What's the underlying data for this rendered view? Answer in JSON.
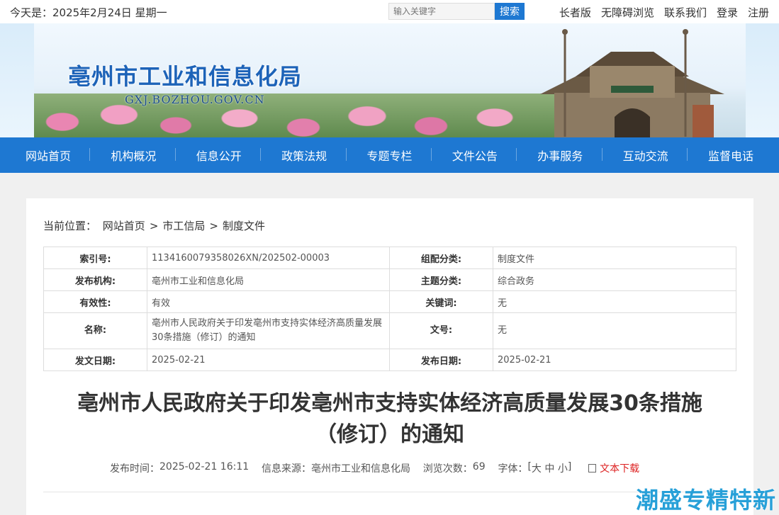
{
  "topbar": {
    "date_text": "今天是：2025年2月24日 星期一",
    "search_placeholder": "输入关键字",
    "search_button": "搜索",
    "links": [
      "长者版",
      "无障碍浏览",
      "联系我们",
      "登录",
      "注册"
    ]
  },
  "banner": {
    "title": "亳州市工业和信息化局",
    "domain": "GXJ.BOZHOU.GOV.CN"
  },
  "nav": [
    "网站首页",
    "机构概况",
    "信息公开",
    "政策法规",
    "专题专栏",
    "文件公告",
    "办事服务",
    "互动交流",
    "监督电话"
  ],
  "breadcrumb": {
    "label": "当前位置：",
    "items": [
      "网站首页",
      "市工信局",
      "制度文件"
    ],
    "sep": ">"
  },
  "meta": [
    {
      "k1": "索引号:",
      "v1": "1134160079358026XN/202502-00003",
      "k2": "组配分类:",
      "v2": "制度文件"
    },
    {
      "k1": "发布机构:",
      "v1": "亳州市工业和信息化局",
      "k2": "主题分类:",
      "v2": "综合政务"
    },
    {
      "k1": "有效性:",
      "v1": "有效",
      "k2": "关键词:",
      "v2": "无"
    },
    {
      "k1": "名称:",
      "v1": "亳州市人民政府关于印发亳州市支持实体经济高质量发展30条措施（修订）的通知",
      "k2": "文号:",
      "v2": "无"
    },
    {
      "k1": "发文日期:",
      "v1": "2025-02-21",
      "k2": "发布日期:",
      "v2": "2025-02-21"
    }
  ],
  "article": {
    "title_line1": "亳州市人民政府关于印发亳州市支持实体经济高质量发展30条措施",
    "title_line2": "（修订）的通知",
    "publish_time_label": "发布时间：",
    "publish_time": "2025-02-21 16:11",
    "source_label": "信息来源：",
    "source": "亳州市工业和信息化局",
    "views_label": "浏览次数：",
    "views": "69",
    "font_label": "字体：",
    "font_open": "[",
    "font_large": "大",
    "font_medium": "中",
    "font_small": "小",
    "font_close": "]",
    "download": "文本下载"
  },
  "watermark": "潮盛专精特新",
  "colors": {
    "accent": "#1e78d2",
    "download": "#d22222",
    "watermark": "#27a0d8"
  }
}
